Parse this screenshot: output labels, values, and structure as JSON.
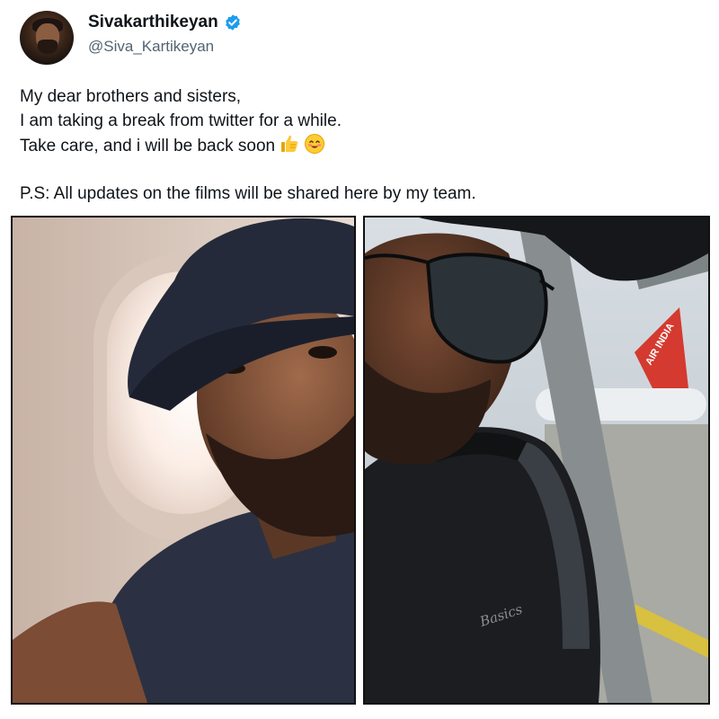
{
  "tweet": {
    "author": {
      "display_name": "Sivakarthikeyan",
      "handle": "@Siva_Kartikeyan",
      "verified": true,
      "verified_color": "#1d9bf0"
    },
    "text_lines": [
      "My dear brothers and sisters,",
      "I am taking a break from twitter for a while.",
      "Take care, and i will be back soon"
    ],
    "emojis": [
      "thumbs-up",
      "smiling-face-with-smiling-eyes"
    ],
    "ps_line": "P.S: All updates on the films will be shared here by my team.",
    "media": {
      "left_photo": "selfie-in-airplane-window-with-black-cap",
      "right_photo": "selfie-with-sunglasses-at-airport-window",
      "right_photo_text": [
        "Basics",
        "AIR INDIA"
      ]
    }
  }
}
